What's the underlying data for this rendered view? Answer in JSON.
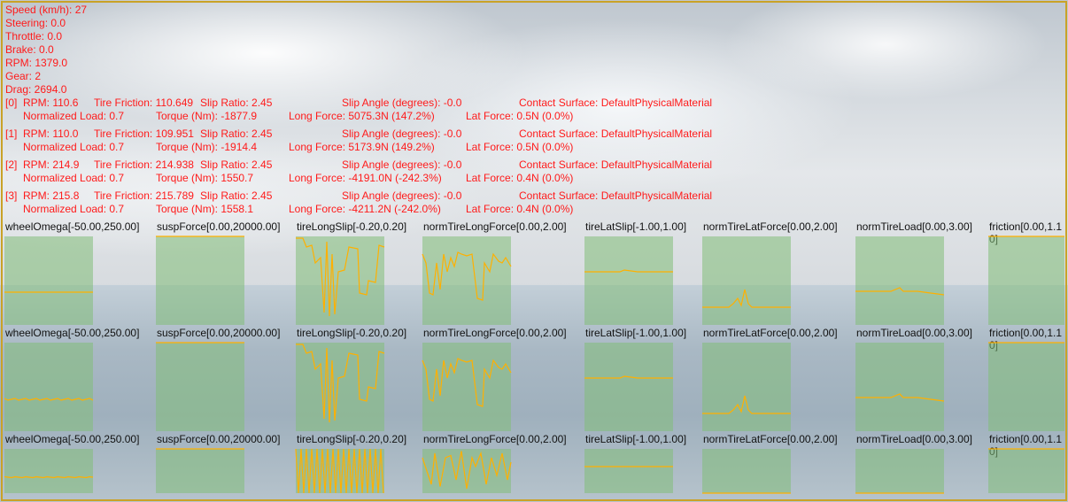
{
  "hud": {
    "speed": "Speed (km/h): 27",
    "steering": "Steering: 0.0",
    "throttle": "Throttle: 0.0",
    "brake": "Brake: 0.0",
    "rpm": "RPM: 1379.0",
    "gear": "Gear: 2",
    "drag": "Drag: 2694.0"
  },
  "wheels": [
    {
      "index": "[0]",
      "rpm": "RPM: 110.6",
      "friction": "Tire Friction: 110.649",
      "slip_ratio": "Slip Ratio: 2.45",
      "slip_angle": "Slip Angle (degrees): -0.0",
      "surface": "Contact Surface: DefaultPhysicalMaterial",
      "norm_load": "Normalized Load: 0.7",
      "torque": "Torque (Nm): -1877.9",
      "long_force": "Long Force: 5075.3N (147.2%)",
      "lat_force": "Lat Force: 0.5N (0.0%)"
    },
    {
      "index": "[1]",
      "rpm": "RPM: 110.0",
      "friction": "Tire Friction: 109.951",
      "slip_ratio": "Slip Ratio: 2.45",
      "slip_angle": "Slip Angle (degrees): -0.0",
      "surface": "Contact Surface: DefaultPhysicalMaterial",
      "norm_load": "Normalized Load: 0.7",
      "torque": "Torque (Nm): -1914.4",
      "long_force": "Long Force: 5173.9N (149.2%)",
      "lat_force": "Lat Force: 0.5N (0.0%)"
    },
    {
      "index": "[2]",
      "rpm": "RPM: 214.9",
      "friction": "Tire Friction: 214.938",
      "slip_ratio": "Slip Ratio: 2.45",
      "slip_angle": "Slip Angle (degrees): -0.0",
      "surface": "Contact Surface: DefaultPhysicalMaterial",
      "norm_load": "Normalized Load: 0.7",
      "torque": "Torque (Nm): 1550.7",
      "long_force": "Long Force: -4191.0N (-242.3%)",
      "lat_force": "Lat Force: 0.4N (0.0%)"
    },
    {
      "index": "[3]",
      "rpm": "RPM: 215.8",
      "friction": "Tire Friction: 215.789",
      "slip_ratio": "Slip Ratio: 2.45",
      "slip_angle": "Slip Angle (degrees): -0.0",
      "surface": "Contact Surface: DefaultPhysicalMaterial",
      "norm_load": "Normalized Load: 0.7",
      "torque": "Torque (Nm): 1558.1",
      "long_force": "Long Force: -4211.2N (-242.0%)",
      "lat_force": "Lat Force: 0.4N (0.0%)"
    }
  ],
  "graph_titles": [
    "wheelOmega[-50.00,250.00]",
    "suspForce[0.00,20000.00]",
    "tireLongSlip[-0.20,0.20]",
    "normTireLongForce[0.00,2.00]",
    "tireLatSlip[-1.00,1.00]",
    "normTireLatForce[0.00,2.00]",
    "normTireLoad[0.00,3.00]",
    "friction[0.00,1.10]"
  ],
  "colors": {
    "hud_text": "#ff1a1a",
    "graph_trace": "#ffb000",
    "graph_bg": "#82be78",
    "frame": "#c9a227"
  }
}
